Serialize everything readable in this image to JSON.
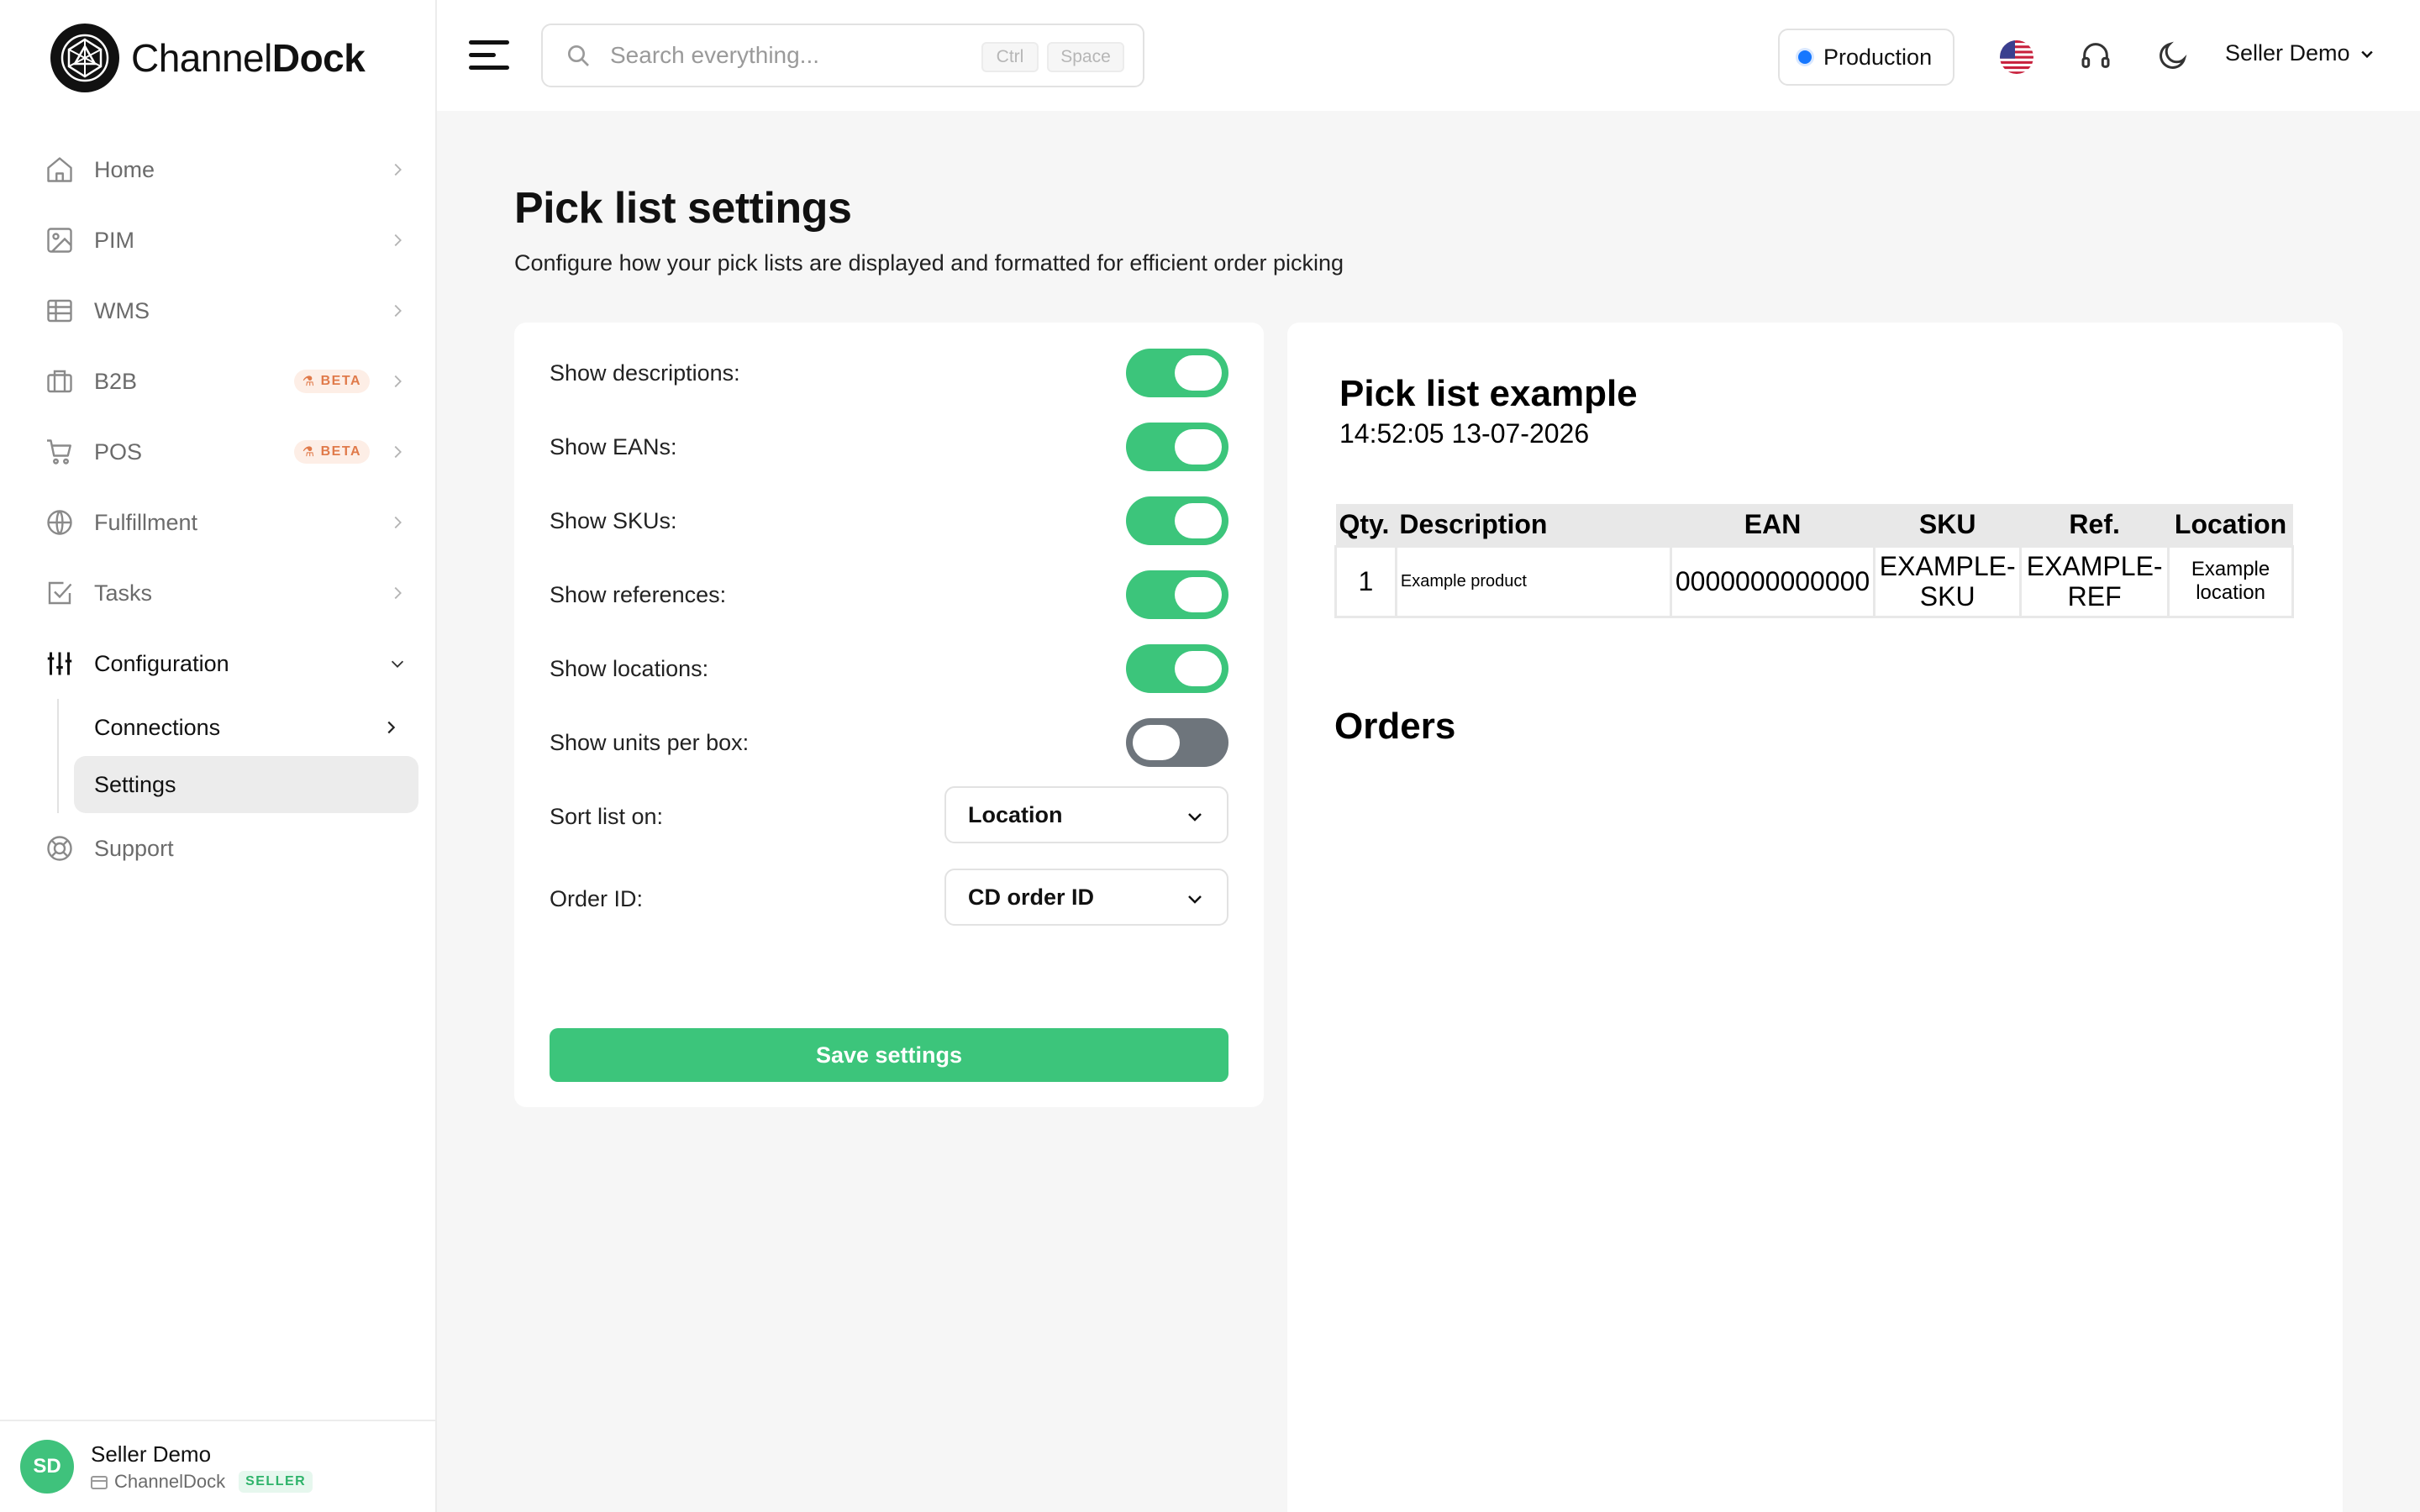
{
  "brand": {
    "name_regular": "Channel",
    "name_bold": "Dock"
  },
  "header": {
    "search_placeholder": "Search everything...",
    "kbd1": "Ctrl",
    "kbd2": "Space",
    "environment": "Production",
    "user_menu": "Seller Demo"
  },
  "sidebar": {
    "items": [
      {
        "label": "Home",
        "icon": "home-icon"
      },
      {
        "label": "PIM",
        "icon": "image-icon"
      },
      {
        "label": "WMS",
        "icon": "table-icon"
      },
      {
        "label": "B2B",
        "icon": "briefcase-icon",
        "badge": "BETA"
      },
      {
        "label": "POS",
        "icon": "cart-icon",
        "badge": "BETA"
      },
      {
        "label": "Fulfillment",
        "icon": "globe-icon"
      },
      {
        "label": "Tasks",
        "icon": "checkbox-icon"
      },
      {
        "label": "Configuration",
        "icon": "sliders-icon"
      },
      {
        "label": "Support",
        "icon": "lifebuoy-icon"
      }
    ],
    "sub_items": [
      {
        "label": "Connections"
      },
      {
        "label": "Settings"
      }
    ]
  },
  "user": {
    "initials": "SD",
    "name": "Seller Demo",
    "org": "ChannelDock",
    "role": "SELLER"
  },
  "page": {
    "title": "Pick list settings",
    "subtitle": "Configure how your pick lists are displayed and formatted for efficient order picking"
  },
  "settings": {
    "toggles": [
      {
        "label": "Show descriptions:",
        "on": true
      },
      {
        "label": "Show EANs:",
        "on": true
      },
      {
        "label": "Show SKUs:",
        "on": true
      },
      {
        "label": "Show references:",
        "on": true
      },
      {
        "label": "Show locations:",
        "on": true
      },
      {
        "label": "Show units per box:",
        "on": false
      }
    ],
    "sort_label": "Sort list on:",
    "sort_value": "Location",
    "order_id_label": "Order ID:",
    "order_id_value": "CD order ID",
    "save_label": "Save settings"
  },
  "preview": {
    "title": "Pick list example",
    "timestamp": "14:52:05 13-07-2026",
    "columns": [
      "Qty.",
      "Description",
      "EAN",
      "SKU",
      "Ref.",
      "Location"
    ],
    "row": {
      "qty": "1",
      "description": "Example product",
      "ean": "0000000000000",
      "sku": "EXAMPLE-SKU",
      "ref": "EXAMPLE-REF",
      "location": "Example location"
    },
    "orders_heading": "Orders"
  },
  "colors": {
    "accent": "#3cc57b",
    "toggle_off": "#6e757c",
    "env_dot": "#1677ff"
  }
}
